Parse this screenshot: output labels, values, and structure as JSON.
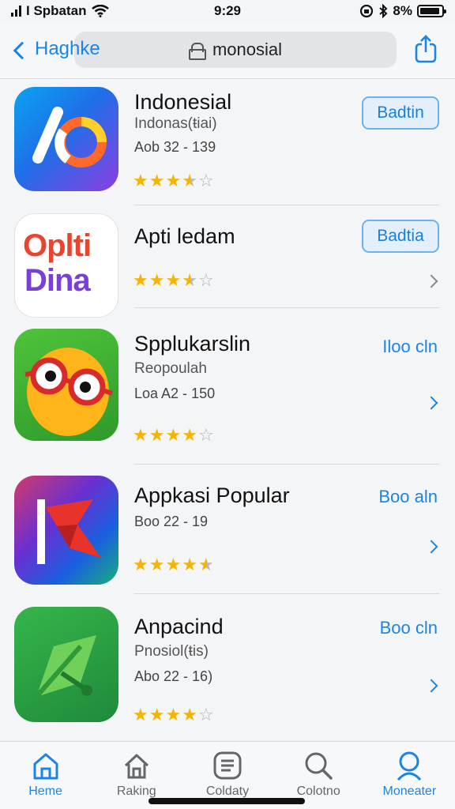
{
  "status_bar": {
    "carrier": "I Spbatan",
    "time": "9:29",
    "battery": "8%"
  },
  "nav": {
    "back_label": "Haghke",
    "search_text": "monosial"
  },
  "apps": [
    {
      "name": "Indonesial",
      "subtitle": "Indonas(ŧiai)",
      "meta": "Aob 32 - 139",
      "rating": 3.5,
      "action_type": "button",
      "action_label": "Badtin",
      "chevron": false,
      "icon": "indonesial-app-icon"
    },
    {
      "name": "Apti ledam",
      "subtitle": "",
      "meta": "",
      "icon_text_line1": "Oplti",
      "icon_text_line2": "Dina",
      "rating": 3.5,
      "action_type": "button",
      "action_label": "Badtia",
      "chevron": true,
      "icon": "optidina-app-icon"
    },
    {
      "name": "Spplukarslin",
      "subtitle": "Reopoulah",
      "meta": "Loa A2 - 150",
      "rating": 4,
      "action_type": "link",
      "action_label": "Iloo cln",
      "chevron": true,
      "icon": "cartoon-face-app-icon"
    },
    {
      "name": "Appkasi Popular",
      "subtitle": "",
      "meta": "Boo 22 - 19",
      "rating": 4.5,
      "action_type": "link",
      "action_label": "Boo aln",
      "chevron": true,
      "icon": "red-logo-app-icon"
    },
    {
      "name": "Anpacind",
      "subtitle": "Pnosiol(ŧis)",
      "meta": "Abo 22 - 16)",
      "rating": 4,
      "action_type": "link",
      "action_label": "Boo cln",
      "chevron": true,
      "icon": "green-leaf-app-icon"
    }
  ],
  "tabs": [
    {
      "label": "Heme",
      "icon": "home-icon",
      "active": true
    },
    {
      "label": "Raking",
      "icon": "house-outline-icon",
      "active": false
    },
    {
      "label": "Coldaty",
      "icon": "list-icon",
      "active": false
    },
    {
      "label": "Colotno",
      "icon": "search-icon",
      "active": false
    },
    {
      "label": "Moneater",
      "icon": "search-icon",
      "active": true
    }
  ],
  "colors": {
    "accent": "#1b84e6",
    "star": "#f4b400",
    "background": "#f4f5f7"
  }
}
